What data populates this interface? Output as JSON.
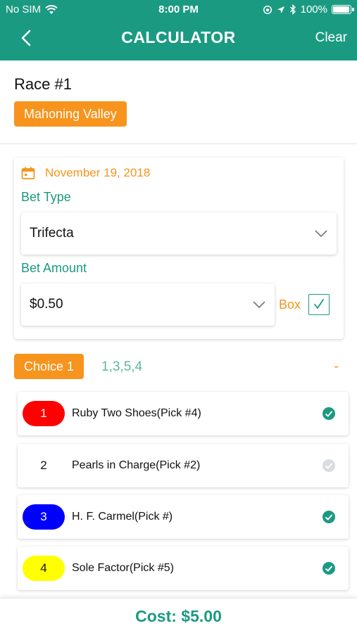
{
  "status_bar": {
    "carrier": "No SIM",
    "time": "8:00 PM",
    "battery": "100%",
    "battery_level": 1.0
  },
  "nav": {
    "title": "CALCULATOR",
    "clear_label": "Clear"
  },
  "race": {
    "title": "Race #1",
    "track": "Mahoning Valley"
  },
  "bet": {
    "date": "November 19, 2018",
    "bet_type_label": "Bet Type",
    "bet_type_value": "Trifecta",
    "bet_amount_label": "Bet Amount",
    "bet_amount_value": "$0.50",
    "box_label": "Box",
    "box_checked": true
  },
  "choice": {
    "label": "Choice 1",
    "values": "1,3,5,4",
    "remove_label": "-"
  },
  "horses": [
    {
      "number": "1",
      "name": "Ruby Two Shoes(Pick #4)",
      "color": "#ff0000",
      "text_color": "#ffffff",
      "selected": true
    },
    {
      "number": "2",
      "name": "Pearls in Charge(Pick #2)",
      "color": "#ffffff",
      "text_color": "#111111",
      "selected": false
    },
    {
      "number": "3",
      "name": "H. F. Carmel(Pick #)",
      "color": "#0000ff",
      "text_color": "#ffffff",
      "selected": true
    },
    {
      "number": "4",
      "name": "Sole Factor(Pick #5)",
      "color": "#ffff00",
      "text_color": "#111111",
      "selected": true
    }
  ],
  "footer": {
    "cost": "Cost: $5.00"
  },
  "colors": {
    "primary": "#1b9a82",
    "accent": "#f7941d",
    "check_on": "#1b9a82",
    "check_off": "#d9dde1"
  }
}
